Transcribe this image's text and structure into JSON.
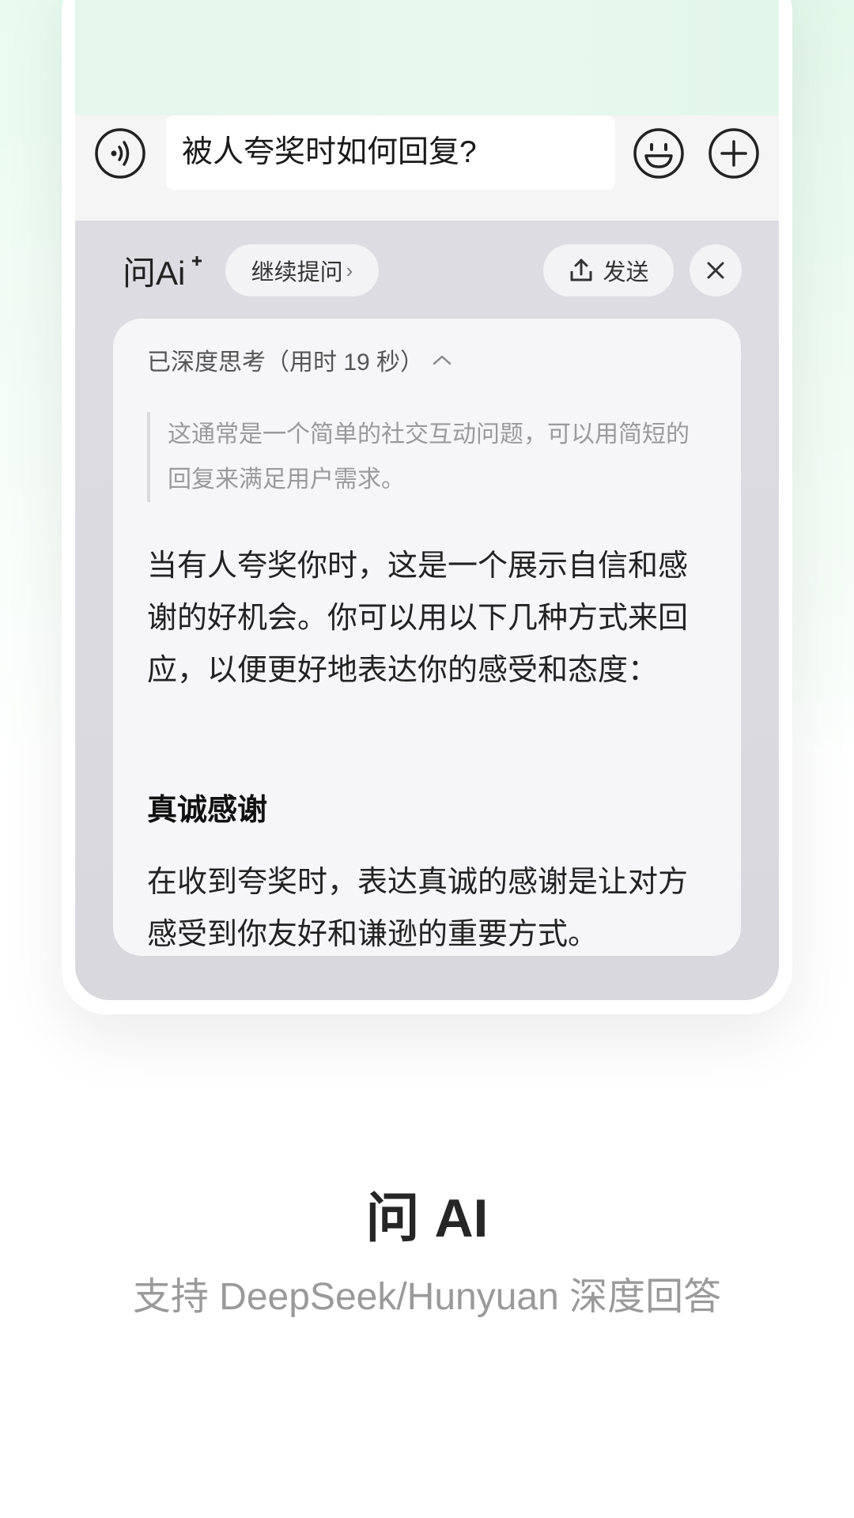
{
  "composer": {
    "input_value": "被人夸奖时如何回复?"
  },
  "ai_panel": {
    "logo_text": "问Ai",
    "continue_label": "继续提问",
    "send_label": "发送"
  },
  "card": {
    "think_header": "已深度思考（用时 19 秒）",
    "think_text": "这通常是一个简单的社交互动问题，可以用简短的回复来满足用户需求。",
    "answer_intro": "当有人夸奖你时，这是一个展示自信和感谢的好机会。你可以用以下几种方式来回应，以便更好地表达你的感受和态度：",
    "section_title": "真诚感谢",
    "section_text": "在收到夸奖时，表达真诚的感谢是让对方感受到你友好和谦逊的重要方式。"
  },
  "caption": {
    "title": "问 AI",
    "subtitle": "支持 DeepSeek/Hunyuan 深度回答"
  },
  "colors": {
    "panel_bg": "#d9d9de",
    "card_bg": "#f6f6f8",
    "screen_top": "#e6f6ec"
  },
  "icons": {
    "voice": "voice-icon",
    "emoji": "emoji-icon",
    "plus": "plus-icon",
    "share": "share-icon",
    "close": "close-icon",
    "chevron_up": "chevron-up-icon",
    "chevron_right": "chevron-right-icon"
  }
}
